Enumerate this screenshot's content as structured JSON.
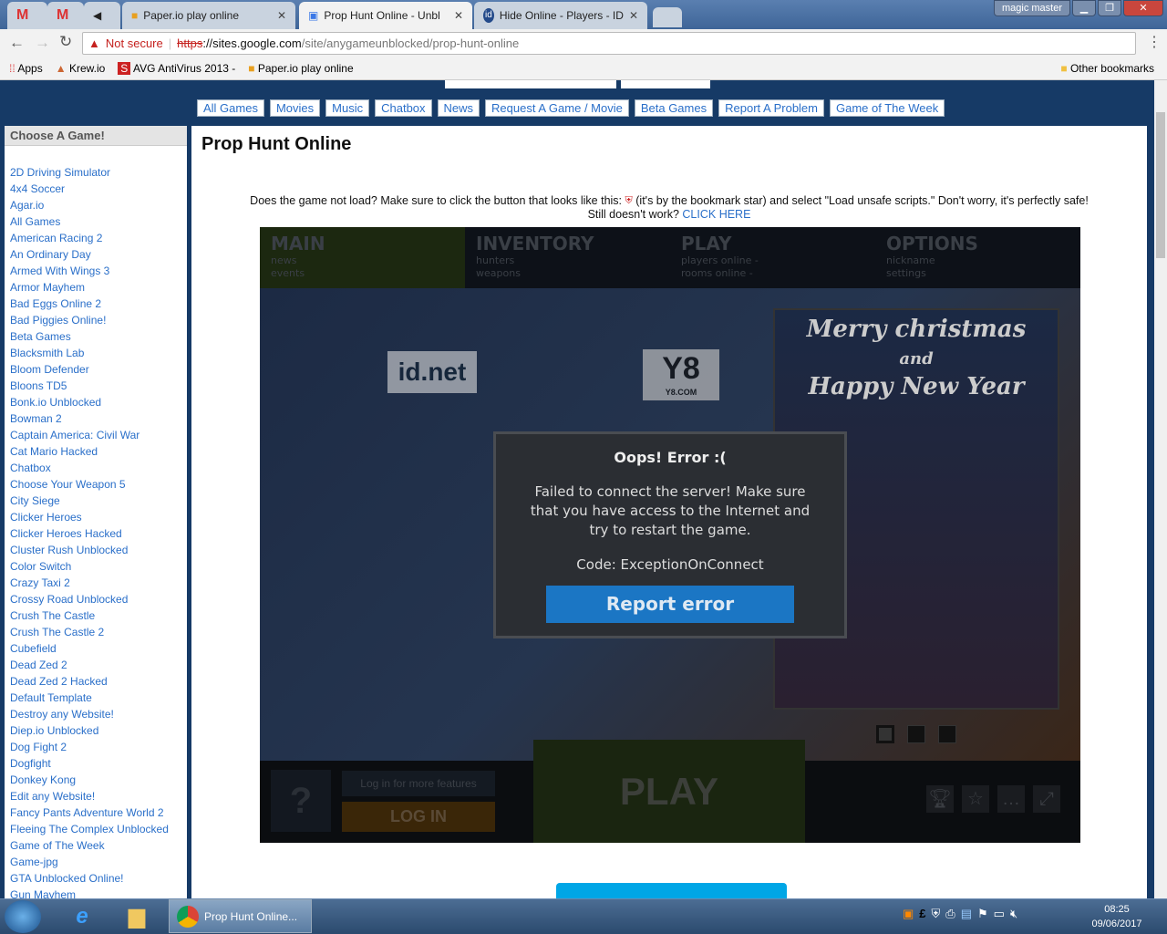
{
  "browser": {
    "tabs": [
      {
        "label": "",
        "icon": "gmail-icon"
      },
      {
        "label": "",
        "icon": "gmail-icon"
      },
      {
        "label": "",
        "icon": "speaker-icon"
      },
      {
        "label": "Paper.io play online",
        "icon": "paperio-icon"
      },
      {
        "label": "Prop Hunt Online - Unbl",
        "icon": "google-sites-icon",
        "active": true
      },
      {
        "label": "Hide Online - Players - ID",
        "icon": "idnet-icon"
      }
    ],
    "profile": "magic master",
    "security": "Not secure",
    "url_scheme": "https",
    "url_host": "://sites.google.com",
    "url_path": "/site/anygameunblocked/prop-hunt-online",
    "bookmarks": [
      "Apps",
      "Krew.io",
      "AVG AntiVirus 2013 -",
      "Paper.io play online"
    ],
    "other_bookmarks": "Other bookmarks"
  },
  "nav": [
    "All Games",
    "Movies",
    "Music",
    "Chatbox",
    "News",
    "Request A Game / Movie",
    "Beta Games",
    "Report A Problem",
    "Game of The Week"
  ],
  "sidebar": {
    "title": "Choose A Game!",
    "items": [
      "2D Driving Simulator",
      "4x4 Soccer",
      "Agar.io",
      "All Games",
      "American Racing 2",
      "An Ordinary Day",
      "Armed With Wings 3",
      "Armor Mayhem",
      "Bad Eggs Online 2",
      "Bad Piggies Online!",
      "Beta Games",
      "Blacksmith Lab",
      "Bloom Defender",
      "Bloons TD5",
      "Bonk.io Unblocked",
      "Bowman 2",
      "Captain America: Civil War",
      "Cat Mario Hacked",
      "Chatbox",
      "Choose Your Weapon 5",
      "City Siege",
      "Clicker Heroes",
      "Clicker Heroes Hacked",
      "Cluster Rush Unblocked",
      "Color Switch",
      "Crazy Taxi 2",
      "Crossy Road Unblocked",
      "Crush The Castle",
      "Crush The Castle 2",
      "Cubefield",
      "Dead Zed 2",
      "Dead Zed 2 Hacked",
      "Default Template",
      "Destroy any Website!",
      "Diep.io Unblocked",
      "Dog Fight 2",
      "Dogfight",
      "Donkey Kong",
      "Edit any Website!",
      "Fancy Pants Adventure World 2",
      "Fleeing The Complex Unblocked",
      "Game of The Week",
      "Game-jpg",
      "GTA Unblocked Online!",
      "Gun Mayhem"
    ]
  },
  "page": {
    "title": "Prop Hunt Online",
    "help_line1a": "Does the game not load? Make sure to click the button that looks like this:",
    "help_line1b": "(it's by the bookmark star) and select \"Load unsafe scripts.\" Don't worry, it's perfectly safe!",
    "help_line2": "Still doesn't work?",
    "help_link": "CLICK HERE"
  },
  "game": {
    "menu": [
      {
        "title": "MAIN",
        "sub": [
          "news",
          "events"
        ]
      },
      {
        "title": "INVENTORY",
        "sub": [
          "hunters",
          "weapons"
        ]
      },
      {
        "title": "PLAY",
        "sub": [
          "players online -",
          "rooms online -"
        ]
      },
      {
        "title": "OPTIONS",
        "sub": [
          "nickname",
          "settings"
        ]
      }
    ],
    "logo_idnet": "id.net",
    "logo_y8": "Y8",
    "logo_y8_sub": "Y8.COM",
    "banner": [
      "Merry christmas",
      "and",
      "Happy New Year"
    ],
    "login_hint": "Log in for more features",
    "login": "LOG IN",
    "play": "PLAY",
    "dialog": {
      "title": "Oops! Error :(",
      "message": "Failed to connect the server! Make sure that you have access to the Internet and try to restart the game.",
      "code": "Code: ExceptionOnConnect",
      "button": "Report error"
    }
  },
  "taskbar": {
    "task": "Prop Hunt Online...",
    "time": "08:25",
    "date": "09/06/2017"
  }
}
